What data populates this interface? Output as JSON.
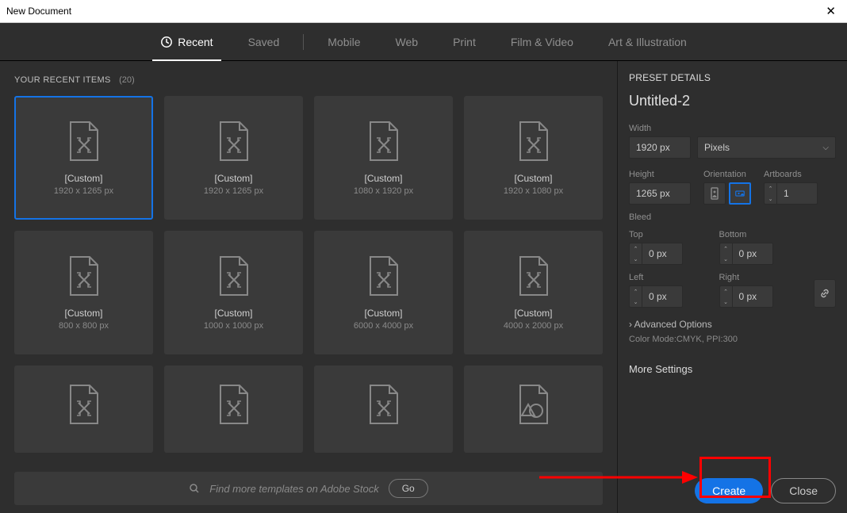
{
  "window_title": "New Document",
  "tabs": {
    "recent": "Recent",
    "saved": "Saved",
    "mobile": "Mobile",
    "web": "Web",
    "print": "Print",
    "film": "Film & Video",
    "art": "Art & Illustration"
  },
  "recent": {
    "heading": "YOUR RECENT ITEMS",
    "count": "(20)",
    "items": [
      {
        "name": "[Custom]",
        "dim": "1920 x 1265 px",
        "selected": true,
        "icon": "doc"
      },
      {
        "name": "[Custom]",
        "dim": "1920 x 1265 px",
        "icon": "doc"
      },
      {
        "name": "[Custom]",
        "dim": "1080 x 1920 px",
        "icon": "doc"
      },
      {
        "name": "[Custom]",
        "dim": "1920 x 1080 px",
        "icon": "doc"
      },
      {
        "name": "[Custom]",
        "dim": "800 x 800 px",
        "icon": "doc"
      },
      {
        "name": "[Custom]",
        "dim": "1000 x 1000 px",
        "icon": "doc"
      },
      {
        "name": "[Custom]",
        "dim": "6000 x 4000 px",
        "icon": "doc"
      },
      {
        "name": "[Custom]",
        "dim": "4000 x 2000 px",
        "icon": "doc"
      },
      {
        "name": "",
        "dim": "",
        "icon": "doc",
        "row3": true
      },
      {
        "name": "",
        "dim": "",
        "icon": "doc",
        "row3": true
      },
      {
        "name": "",
        "dim": "",
        "icon": "doc",
        "row3": true
      },
      {
        "name": "",
        "dim": "",
        "icon": "shape",
        "row3": true
      }
    ]
  },
  "search": {
    "placeholder": "Find more templates on Adobe Stock",
    "go": "Go"
  },
  "preset": {
    "heading": "PRESET DETAILS",
    "name": "Untitled-2",
    "width_label": "Width",
    "width_value": "1920 px",
    "units": "Pixels",
    "height_label": "Height",
    "height_value": "1265 px",
    "orientation_label": "Orientation",
    "artboards_label": "Artboards",
    "artboards_value": "1",
    "bleed_label": "Bleed",
    "top_label": "Top",
    "bottom_label": "Bottom",
    "left_label": "Left",
    "right_label": "Right",
    "bleed_value": "0 px",
    "advanced": "Advanced Options",
    "mode": "Color Mode:CMYK, PPI:300",
    "more": "More Settings"
  },
  "buttons": {
    "create": "Create",
    "close": "Close"
  }
}
